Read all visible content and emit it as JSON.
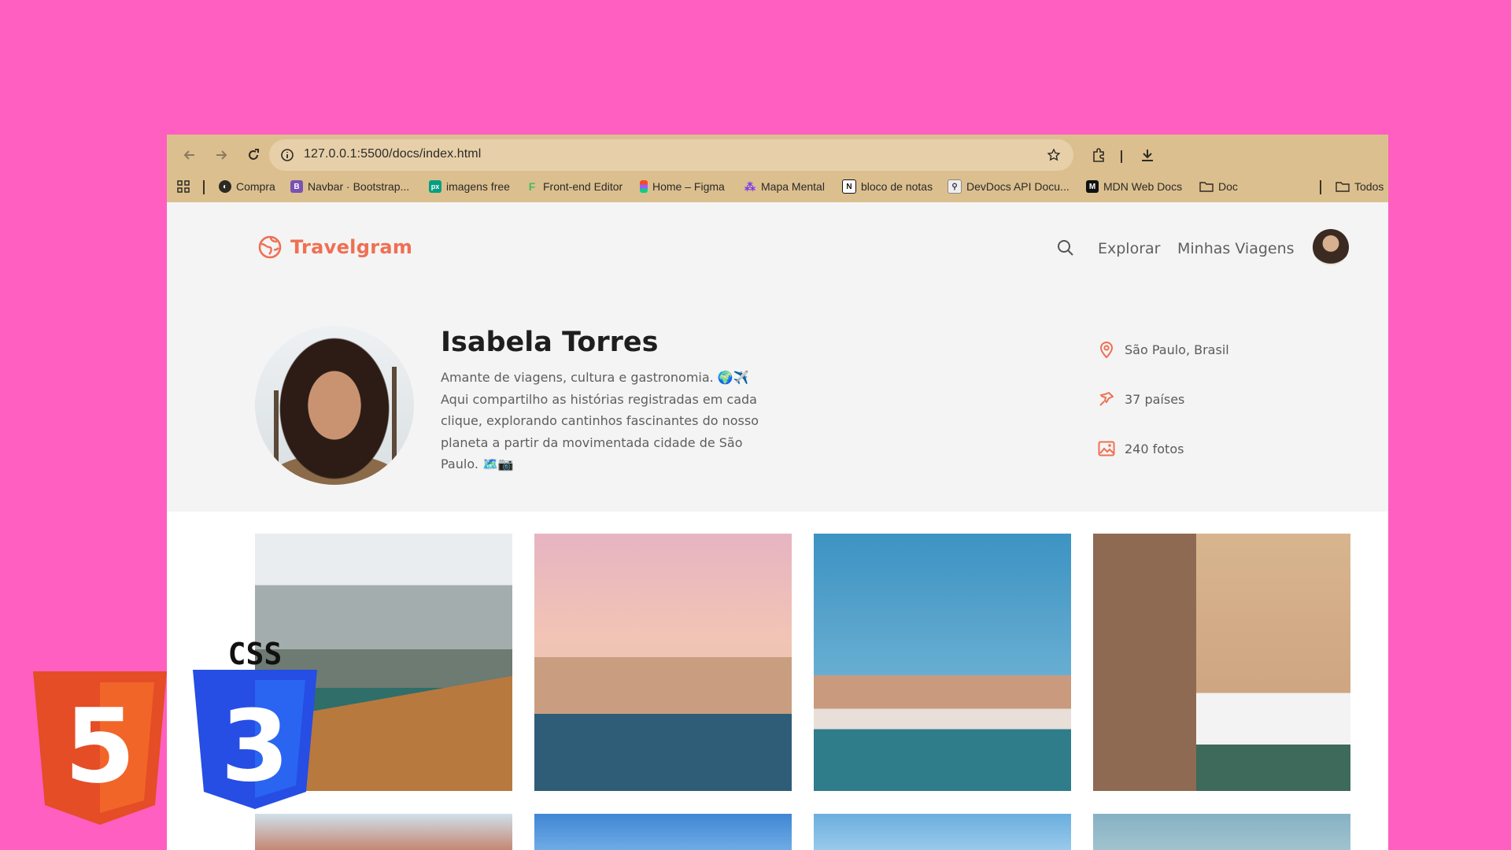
{
  "browser": {
    "url": "127.0.0.1:5500/docs/index.html",
    "bookmarks": [
      {
        "label": "Compra",
        "icon": "globe-icon"
      },
      {
        "label": "Navbar · Bootstrap...",
        "icon": "bootstrap-icon",
        "color": "#7952b3"
      },
      {
        "label": "imagens free",
        "icon": "pexels-icon",
        "color": "#05a081"
      },
      {
        "label": "Front-end Editor",
        "icon": "frontend-editor-icon",
        "color": "#3fbf5f"
      },
      {
        "label": "Home – Figma",
        "icon": "figma-icon"
      },
      {
        "label": "Mapa Mental",
        "icon": "mind-map-icon",
        "color": "#7c3aed"
      },
      {
        "label": "bloco de notas",
        "icon": "notion-icon"
      },
      {
        "label": "DevDocs API Docu...",
        "icon": "devdocs-icon"
      },
      {
        "label": "MDN Web Docs",
        "icon": "mdn-icon"
      },
      {
        "label": "Doc",
        "icon": "folder-icon"
      }
    ],
    "all_bookmarks_label": "Todos"
  },
  "site": {
    "logo_text": "Travelgram",
    "accent_color": "#ef6f53",
    "nav": [
      "Explorar",
      "Minhas Viagens"
    ]
  },
  "profile": {
    "name": "Isabela Torres",
    "bio_lines": [
      "Amante de viagens, cultura e gastronomia. 🌍✈️",
      "Aqui compartilho as histórias registradas em cada",
      "clique, explorando cantinhos fascinantes do nosso",
      "planeta a partir da movimentada cidade de São",
      "Paulo. 🗺️📷"
    ],
    "location": "São Paulo, Brasil",
    "countries": "37 países",
    "photos": "240 fotos"
  },
  "gallery": {
    "photos": [
      {
        "subject": "lake-boat"
      },
      {
        "subject": "venice-canal-sunset"
      },
      {
        "subject": "rialto-bridge"
      },
      {
        "subject": "venice-restaurant"
      },
      {
        "subject": "coastal-village"
      },
      {
        "subject": "sky"
      },
      {
        "subject": "sky"
      },
      {
        "subject": "sky"
      }
    ]
  },
  "overlay": {
    "css_label": "CSS",
    "html5_badge": "5",
    "css3_badge": "3"
  }
}
